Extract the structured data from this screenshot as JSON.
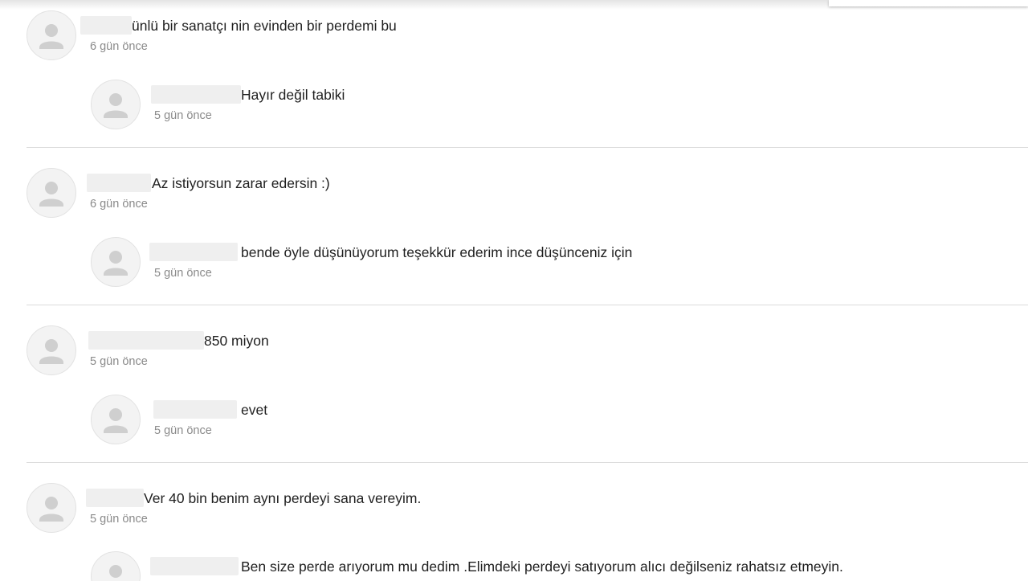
{
  "threads": [
    {
      "comment": {
        "text": "ünlü bir sanatçı nin evinden bir perdemi bu",
        "time": "6 gün önce"
      },
      "reply": {
        "text": "Hayır değil tabiki",
        "time": "5 gün önce"
      }
    },
    {
      "comment": {
        "text": "Az istiyorsun zarar edersin :)",
        "time": "6 gün önce"
      },
      "reply": {
        "text": "bende öyle düşünüyorum teşekkür ederim ince düşünceniz için",
        "time": "5 gün önce"
      }
    },
    {
      "comment": {
        "text": "850 miyon",
        "time": "5 gün önce"
      },
      "reply": {
        "text": "evet",
        "time": "5 gün önce"
      }
    },
    {
      "comment": {
        "text": "Ver 40 bin benim aynı perdeyi sana vereyim.",
        "time": "5 gün önce"
      },
      "reply": {
        "text": "Ben size perde arıyorum mu dedim .Elimdeki perdeyi satıyorum alıcı değilseniz rahatsız etmeyin.",
        "time": ""
      }
    }
  ],
  "icons": {
    "avatar": "user-silhouette-icon"
  },
  "colors": {
    "text": "#1f1f1f",
    "muted": "#8a8a8a",
    "divider": "#dcdcdc",
    "avatar_bg": "#f3f3f3",
    "avatar_figure": "#cfcfcf",
    "redaction": "#efefef"
  }
}
